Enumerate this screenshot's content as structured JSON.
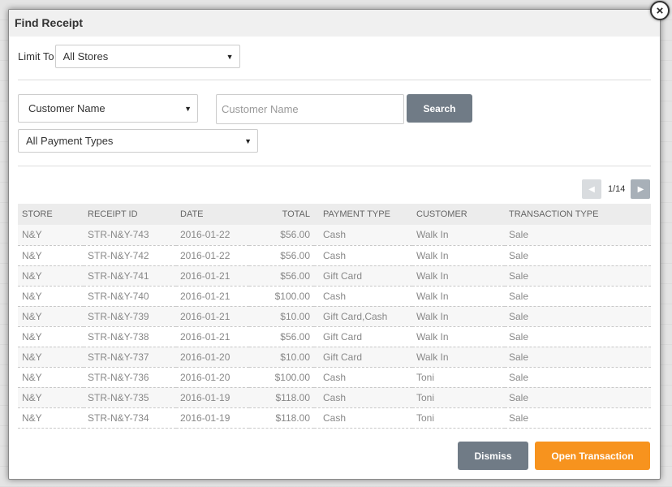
{
  "dialog": {
    "title": "Find Receipt",
    "close_glyph": "×"
  },
  "limit": {
    "label": "Limit To",
    "selected": "All Stores"
  },
  "search": {
    "field_selected": "Customer Name",
    "input_placeholder": "Customer Name",
    "input_value": "",
    "button_label": "Search",
    "payment_selected": "All Payment Types"
  },
  "pager": {
    "text": "1/14",
    "prev_icon": "chevron-left-icon",
    "next_icon": "chevron-right-icon"
  },
  "table": {
    "headers": [
      "STORE",
      "RECEIPT ID",
      "DATE",
      "TOTAL",
      "PAYMENT TYPE",
      "CUSTOMER",
      "TRANSACTION TYPE"
    ],
    "rows": [
      [
        "N&Y",
        "STR-N&Y-743",
        "2016-01-22",
        "$56.00",
        "Cash",
        "Walk In",
        "Sale"
      ],
      [
        "N&Y",
        "STR-N&Y-742",
        "2016-01-22",
        "$56.00",
        "Cash",
        "Walk In",
        "Sale"
      ],
      [
        "N&Y",
        "STR-N&Y-741",
        "2016-01-21",
        "$56.00",
        "Gift Card",
        "Walk In",
        "Sale"
      ],
      [
        "N&Y",
        "STR-N&Y-740",
        "2016-01-21",
        "$100.00",
        "Cash",
        "Walk In",
        "Sale"
      ],
      [
        "N&Y",
        "STR-N&Y-739",
        "2016-01-21",
        "$10.00",
        "Gift Card,Cash",
        "Walk In",
        "Sale"
      ],
      [
        "N&Y",
        "STR-N&Y-738",
        "2016-01-21",
        "$56.00",
        "Gift Card",
        "Walk In",
        "Sale"
      ],
      [
        "N&Y",
        "STR-N&Y-737",
        "2016-01-20",
        "$10.00",
        "Gift Card",
        "Walk In",
        "Sale"
      ],
      [
        "N&Y",
        "STR-N&Y-736",
        "2016-01-20",
        "$100.00",
        "Cash",
        "Toni",
        "Sale"
      ],
      [
        "N&Y",
        "STR-N&Y-735",
        "2016-01-19",
        "$118.00",
        "Cash",
        "Toni",
        "Sale"
      ],
      [
        "N&Y",
        "STR-N&Y-734",
        "2016-01-19",
        "$118.00",
        "Cash",
        "Toni",
        "Sale"
      ]
    ]
  },
  "footer": {
    "dismiss_label": "Dismiss",
    "open_label": "Open Transaction"
  },
  "colors": {
    "gray_button": "#707b86",
    "orange_button": "#f7931e"
  }
}
